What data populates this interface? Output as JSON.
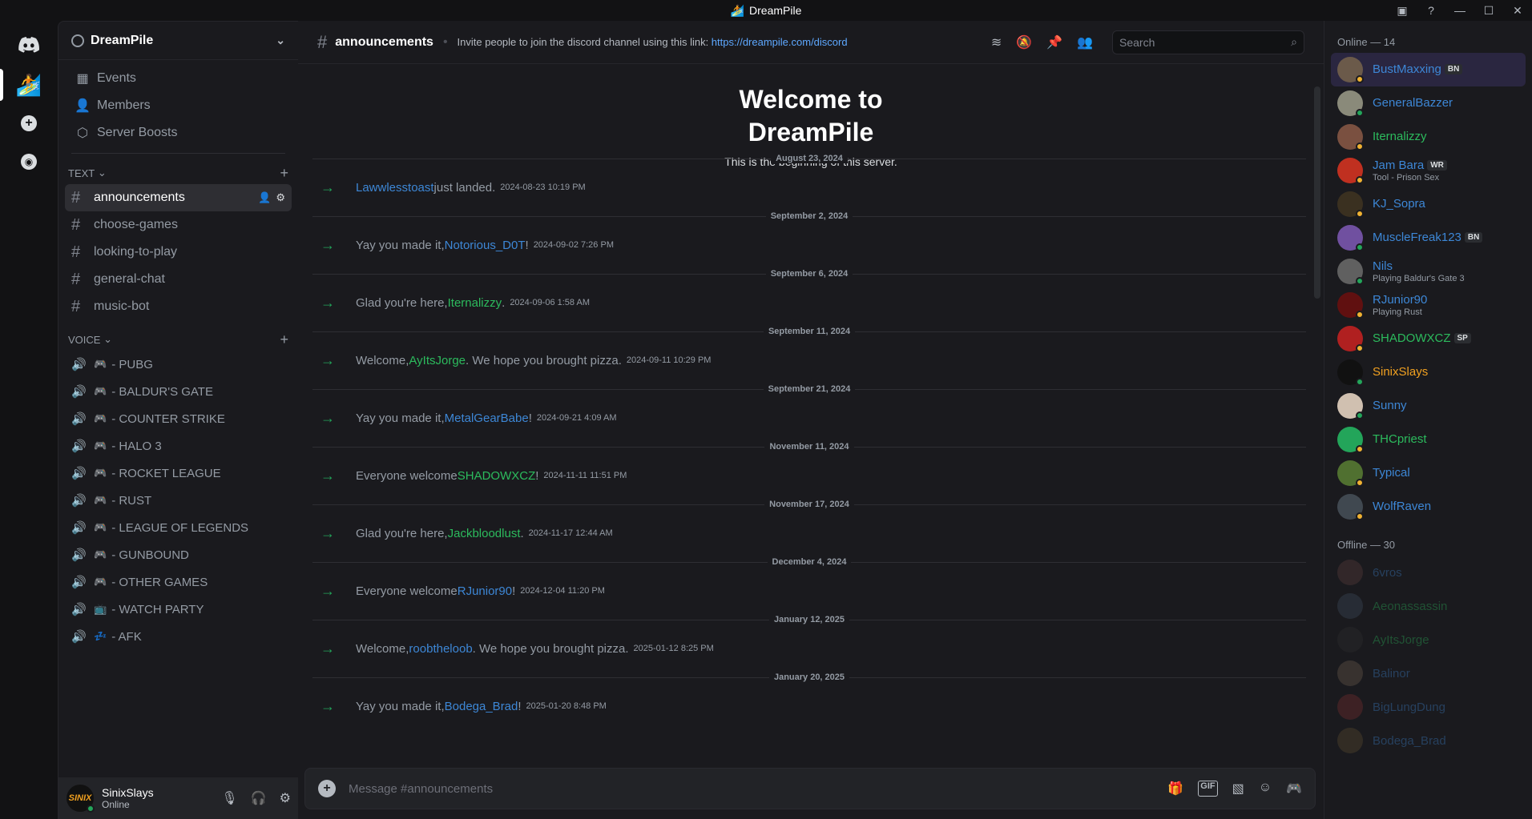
{
  "window": {
    "title": "DreamPile"
  },
  "server": {
    "name": "DreamPile"
  },
  "nav": [
    {
      "label": "Events",
      "icon": "calendar-icon"
    },
    {
      "label": "Members",
      "icon": "members-icon"
    },
    {
      "label": "Server Boosts",
      "icon": "boost-icon"
    }
  ],
  "text_category": "TEXT",
  "voice_category": "VOICE",
  "text_channels": [
    "announcements",
    "choose-games",
    "looking-to-play",
    "general-chat",
    "music-bot"
  ],
  "voice_channels": [
    {
      "label": "- PUBG",
      "emoji": "🎮"
    },
    {
      "label": "- BALDUR'S GATE",
      "emoji": "🎮"
    },
    {
      "label": "- COUNTER STRIKE",
      "emoji": "🎮"
    },
    {
      "label": "- HALO 3",
      "emoji": "🎮"
    },
    {
      "label": "- ROCKET LEAGUE",
      "emoji": "🎮"
    },
    {
      "label": "- RUST",
      "emoji": "🎮"
    },
    {
      "label": "- LEAGUE OF LEGENDS",
      "emoji": "🎮"
    },
    {
      "label": "- GUNBOUND",
      "emoji": "🎮"
    },
    {
      "label": "- OTHER GAMES",
      "emoji": "🎮"
    },
    {
      "label": "- WATCH PARTY",
      "emoji": "📺"
    },
    {
      "label": "- AFK",
      "emoji": "💤"
    }
  ],
  "user": {
    "name": "SinixSlays",
    "status": "Online",
    "avatar_text": "SINIX"
  },
  "channel": {
    "name": "announcements",
    "topic_prefix": "Invite people to join the discord channel using this link: ",
    "topic_link": "https://dreampile.com/discord",
    "search_placeholder": "Search"
  },
  "welcome": {
    "title": "Welcome to DreamPile",
    "subtitle": "This is the beginning of this server."
  },
  "messages": [
    {
      "date": "August 23, 2024",
      "pre": "",
      "name": "Lawwlesstoast",
      "post": " just landed.",
      "time": "2024-08-23 10:19 PM",
      "color": "blue"
    },
    {
      "date": "September 2, 2024",
      "pre": "Yay you made it, ",
      "name": "Notorious_D0T",
      "post": "!",
      "time": "2024-09-02 7:26 PM",
      "color": "blue"
    },
    {
      "date": "September 6, 2024",
      "pre": "Glad you're here, ",
      "name": "Iternalizzy",
      "post": ".",
      "time": "2024-09-06 1:58 AM",
      "color": "green"
    },
    {
      "date": "September 11, 2024",
      "pre": "Welcome, ",
      "name": "AyItsJorge",
      "post": ". We hope you brought pizza.",
      "time": "2024-09-11 10:29 PM",
      "color": "green"
    },
    {
      "date": "September 21, 2024",
      "pre": "Yay you made it, ",
      "name": "MetalGearBabe",
      "post": "!",
      "time": "2024-09-21 4:09 AM",
      "color": "blue"
    },
    {
      "date": "November 11, 2024",
      "pre": "Everyone welcome ",
      "name": "SHADOWXCZ",
      "post": "!",
      "time": "2024-11-11 11:51 PM",
      "color": "green"
    },
    {
      "date": "November 17, 2024",
      "pre": "Glad you're here, ",
      "name": "Jackbloodlust",
      "post": ".",
      "time": "2024-11-17 12:44 AM",
      "color": "green"
    },
    {
      "date": "December 4, 2024",
      "pre": "Everyone welcome ",
      "name": "RJunior90",
      "post": "!",
      "time": "2024-12-04 11:20 PM",
      "color": "blue"
    },
    {
      "date": "January 12, 2025",
      "pre": "Welcome, ",
      "name": "roobtheloob",
      "post": ". We hope you brought pizza.",
      "time": "2025-01-12 8:25 PM",
      "color": "blue"
    },
    {
      "date": "January 20, 2025",
      "pre": "Yay you made it, ",
      "name": "Bodega_Brad",
      "post": "!",
      "time": "2025-01-20 8:48 PM",
      "color": "blue"
    }
  ],
  "composer": {
    "placeholder": "Message #announcements"
  },
  "online_header": "Online — 14",
  "offline_header": "Offline — 30",
  "online": [
    {
      "name": "BustMaxxing",
      "tag": "BN",
      "sub": "",
      "color": "#3d87d6",
      "av": "#6b5a4a",
      "status": "#f0b232"
    },
    {
      "name": "GeneralBazzer",
      "tag": "",
      "sub": "",
      "color": "#3d87d6",
      "av": "#8a8a7a",
      "status": "#23a55a"
    },
    {
      "name": "Iternalizzy",
      "tag": "",
      "sub": "",
      "color": "#2cbb5d",
      "av": "#7a5040",
      "status": "#f0b232"
    },
    {
      "name": "Jam Bara",
      "tag": "WR",
      "sub": "Tool - Prison Sex",
      "color": "#3d87d6",
      "av": "#c03020",
      "status": "#f0b232"
    },
    {
      "name": "KJ_Sopra",
      "tag": "",
      "sub": "",
      "color": "#3d87d6",
      "av": "#3a3020",
      "status": "#f0b232"
    },
    {
      "name": "MuscleFreak123",
      "tag": "BN",
      "sub": "",
      "color": "#3d87d6",
      "av": "#7050a0",
      "status": "#23a55a"
    },
    {
      "name": "Nils",
      "tag": "",
      "sub": "Playing Baldur's Gate 3",
      "color": "#3d87d6",
      "av": "#606060",
      "status": "#23a55a"
    },
    {
      "name": "RJunior90",
      "tag": "",
      "sub": "Playing Rust",
      "color": "#3d87d6",
      "av": "#601010",
      "status": "#f0b232"
    },
    {
      "name": "SHADOWXCZ",
      "tag": "SP",
      "sub": "",
      "color": "#2cbb5d",
      "av": "#b02020",
      "status": "#f0b232"
    },
    {
      "name": "SinixSlays",
      "tag": "",
      "sub": "",
      "color": "#f0a020",
      "av": "#111111",
      "status": "#23a55a"
    },
    {
      "name": "Sunny",
      "tag": "",
      "sub": "",
      "color": "#3d87d6",
      "av": "#d0c0b0",
      "status": "#23a55a"
    },
    {
      "name": "THCpriest",
      "tag": "",
      "sub": "",
      "color": "#2cbb5d",
      "av": "#23a55a",
      "status": "#f0b232"
    },
    {
      "name": "Typical",
      "tag": "",
      "sub": "",
      "color": "#3d87d6",
      "av": "#507030",
      "status": "#f0b232"
    },
    {
      "name": "WolfRaven",
      "tag": "",
      "sub": "",
      "color": "#3d87d6",
      "av": "#404850",
      "status": "#f0b232"
    }
  ],
  "offline": [
    {
      "name": "6vros",
      "color": "#3d87d6",
      "av": "#604040"
    },
    {
      "name": "Aeonassassin",
      "color": "#2cbb5d",
      "av": "#405060"
    },
    {
      "name": "AyItsJorge",
      "color": "#2cbb5d",
      "av": "#303030"
    },
    {
      "name": "Balinor",
      "color": "#3d87d6",
      "av": "#706050"
    },
    {
      "name": "BigLungDung",
      "color": "#3d87d6",
      "av": "#803030"
    },
    {
      "name": "Bodega_Brad",
      "color": "#3d87d6",
      "av": "#605030"
    }
  ]
}
